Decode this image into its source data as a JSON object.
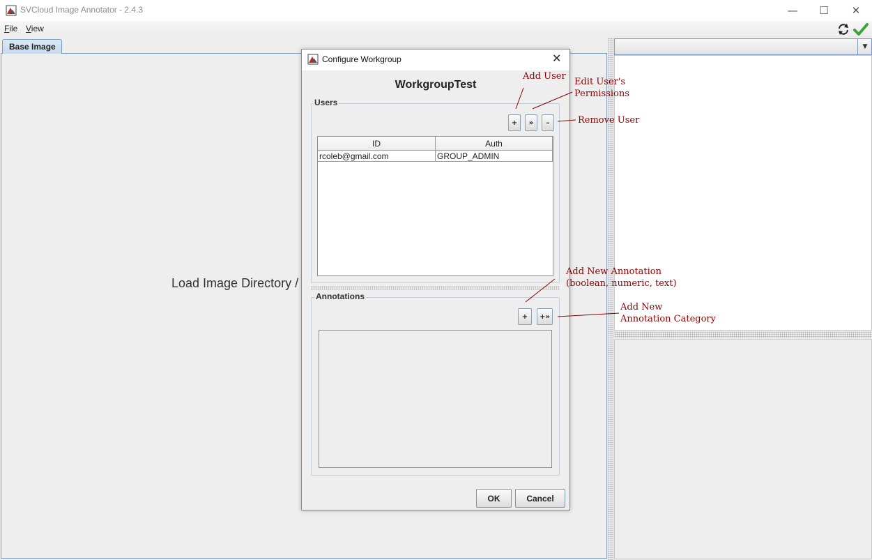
{
  "window": {
    "title": "SVCloud Image Annotator - 2.4.3",
    "controls": {
      "minimize": "—",
      "maximize": "☐",
      "close": "✕"
    }
  },
  "menu": {
    "file": {
      "accel": "F",
      "rest": "ile"
    },
    "view": {
      "accel": "V",
      "rest": "iew"
    }
  },
  "toolbar": {
    "icons": [
      "sync-icon",
      "check-icon"
    ],
    "check_color": "#3aa33a"
  },
  "left_panel": {
    "tab": "Base Image",
    "placeholder": "Load Image Directory / C"
  },
  "right_panel": {
    "combo_arrow": "▼"
  },
  "dialog": {
    "title": "Configure Workgroup",
    "close": "✕",
    "workgroup_name": "WorkgroupTest",
    "users": {
      "title": "Users",
      "buttons": {
        "add": "+",
        "edit": "»",
        "remove": "–"
      },
      "columns": [
        "ID",
        "Auth"
      ],
      "rows": [
        {
          "id": "rcoleb@gmail.com",
          "auth": "GROUP_ADMIN"
        }
      ]
    },
    "annotations": {
      "title": "Annotations",
      "buttons": {
        "add": "+",
        "add_category": "+»"
      }
    },
    "ok": "OK",
    "cancel": "Cancel"
  },
  "callouts": {
    "add_user": "Add User",
    "edit_permissions": [
      "Edit User's",
      "Permissions"
    ],
    "remove_user": "Remove User",
    "add_annotation": [
      "Add New Annotation",
      "(boolean, numeric, text)"
    ],
    "add_category": [
      "Add New",
      "Annotation Category"
    ],
    "color": "#8b0000"
  }
}
